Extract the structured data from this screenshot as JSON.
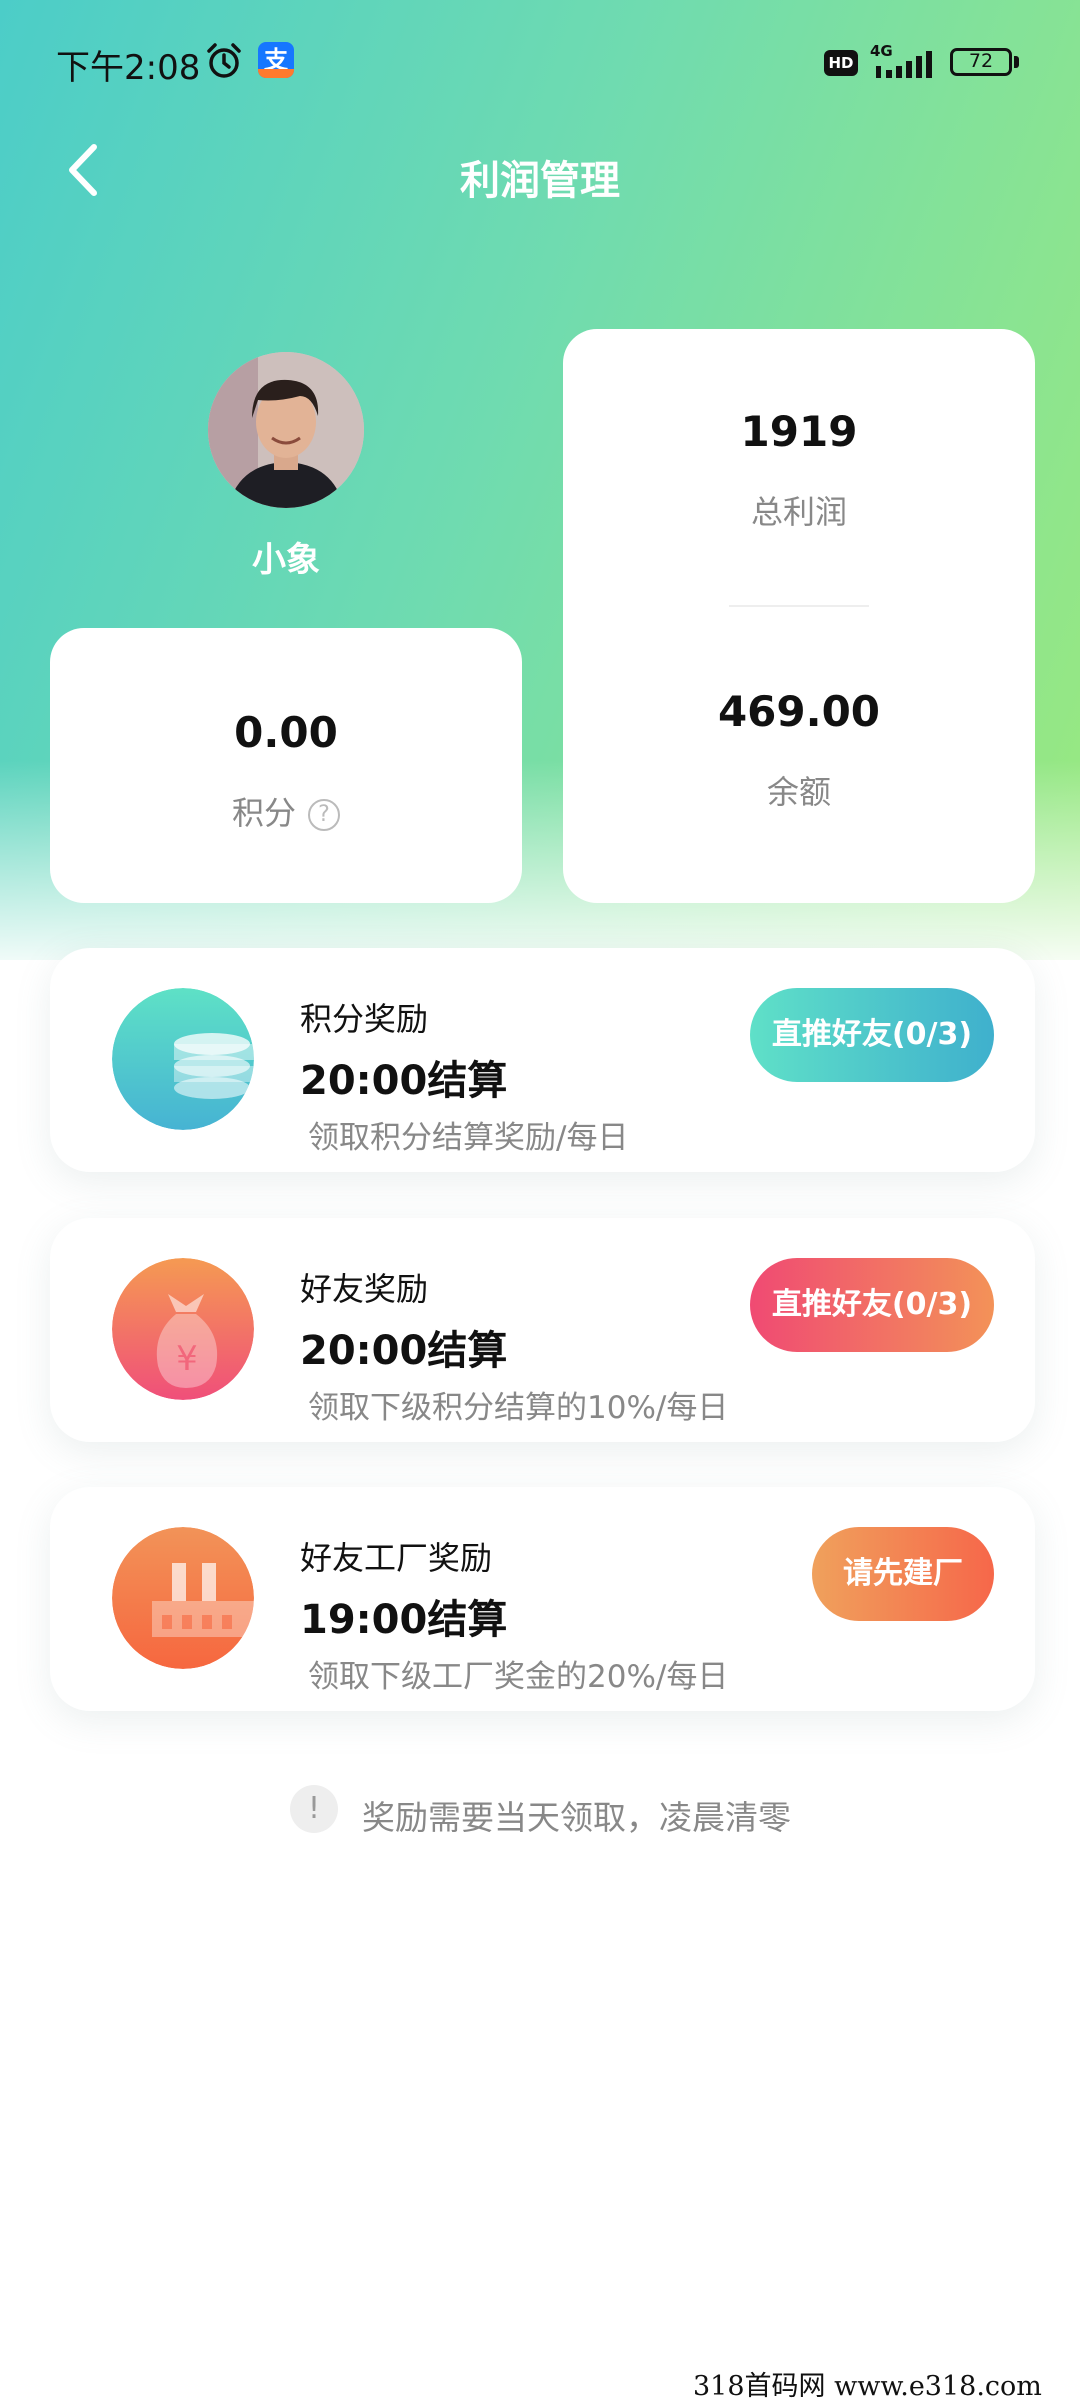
{
  "status_bar": {
    "time": "下午2:08",
    "hd": "HD",
    "network": "4G",
    "battery": "72"
  },
  "header": {
    "title": "利润管理"
  },
  "profile": {
    "username": "小象"
  },
  "stats": {
    "points_value": "0.00",
    "points_label": "积分",
    "total_profit_value": "1919",
    "total_profit_label": "总利润",
    "balance_value": "469.00",
    "balance_label": "余额"
  },
  "rewards": [
    {
      "title": "积分奖励",
      "time": "20:00结算",
      "desc": "领取积分结算奖励/每日",
      "button": "直推好友(0/3)",
      "icon": "coin-stack-icon"
    },
    {
      "title": "好友奖励",
      "time": "20:00结算",
      "desc": "领取下级积分结算的10%/每日",
      "button": "直推好友(0/3)",
      "icon": "money-bag-icon"
    },
    {
      "title": "好友工厂奖励",
      "time": "19:00结算",
      "desc": "领取下级工厂奖金的20%/每日",
      "button": "请先建厂",
      "icon": "factory-icon"
    }
  ],
  "notice": {
    "icon_text": "!",
    "text": "奖励需要当天领取，凌晨清零"
  },
  "watermark": "318首码网  www.e318.com"
}
